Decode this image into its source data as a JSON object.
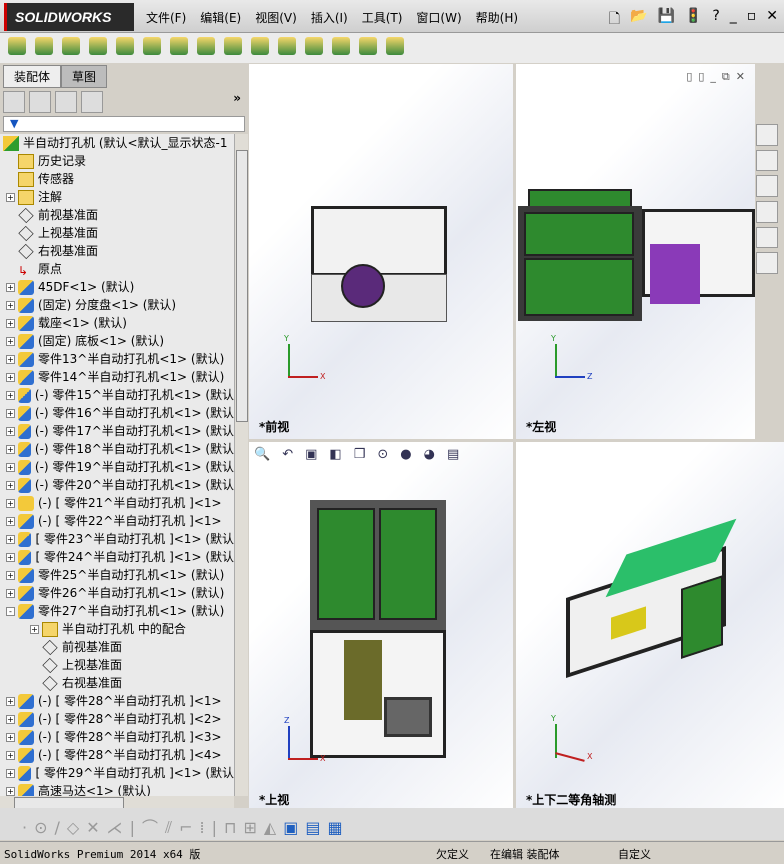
{
  "app": {
    "logo": "SOLIDWORKS",
    "menu": [
      "文件(F)",
      "编辑(E)",
      "视图(V)",
      "插入(I)",
      "工具(T)",
      "窗口(W)",
      "帮助(H)"
    ]
  },
  "side": {
    "tabs": [
      "装配体",
      "草图"
    ],
    "filter_icon": "funnel-icon",
    "tree": [
      {
        "label": "半自动打孔机  (默认<默认_显示状态-1",
        "icon": "root",
        "pm": "",
        "ind": 0
      },
      {
        "label": "历史记录",
        "icon": "fold",
        "pm": "",
        "ind": 1
      },
      {
        "label": "传感器",
        "icon": "fold",
        "pm": "",
        "ind": 1
      },
      {
        "label": "注解",
        "icon": "fold",
        "pm": "+",
        "ind": 1
      },
      {
        "label": "前视基准面",
        "icon": "plane",
        "pm": "",
        "ind": 1
      },
      {
        "label": "上视基准面",
        "icon": "plane",
        "pm": "",
        "ind": 1
      },
      {
        "label": "右视基准面",
        "icon": "plane",
        "pm": "",
        "ind": 1
      },
      {
        "label": "原点",
        "icon": "",
        "pm": "",
        "ind": 1
      },
      {
        "label": "45DF<1> (默认)",
        "icon": "asm",
        "pm": "+",
        "ind": 1
      },
      {
        "label": "(固定) 分度盘<1> (默认)",
        "icon": "asm",
        "pm": "+",
        "ind": 1
      },
      {
        "label": "载座<1> (默认)",
        "icon": "asm",
        "pm": "+",
        "ind": 1
      },
      {
        "label": "(固定) 底板<1> (默认)",
        "icon": "asm",
        "pm": "+",
        "ind": 1
      },
      {
        "label": "零件13^半自动打孔机<1> (默认)",
        "icon": "asm",
        "pm": "+",
        "ind": 1
      },
      {
        "label": "零件14^半自动打孔机<1> (默认)",
        "icon": "asm",
        "pm": "+",
        "ind": 1
      },
      {
        "label": "(-) 零件15^半自动打孔机<1> (默认",
        "icon": "asm",
        "pm": "+",
        "ind": 1
      },
      {
        "label": "(-) 零件16^半自动打孔机<1> (默认",
        "icon": "asm",
        "pm": "+",
        "ind": 1
      },
      {
        "label": "(-) 零件17^半自动打孔机<1> (默认",
        "icon": "asm",
        "pm": "+",
        "ind": 1
      },
      {
        "label": "(-) 零件18^半自动打孔机<1> (默认",
        "icon": "asm",
        "pm": "+",
        "ind": 1
      },
      {
        "label": "(-) 零件19^半自动打孔机<1> (默认",
        "icon": "asm",
        "pm": "+",
        "ind": 1
      },
      {
        "label": "(-) 零件20^半自动打孔机<1> (默认",
        "icon": "asm",
        "pm": "+",
        "ind": 1
      },
      {
        "label": "(-) [ 零件21^半自动打孔机 ]<1>",
        "icon": "part",
        "pm": "+",
        "ind": 1
      },
      {
        "label": "(-) [ 零件22^半自动打孔机 ]<1>",
        "icon": "asm",
        "pm": "+",
        "ind": 1
      },
      {
        "label": "[ 零件23^半自动打孔机 ]<1> (默认",
        "icon": "asm",
        "pm": "+",
        "ind": 1
      },
      {
        "label": "[ 零件24^半自动打孔机 ]<1> (默认",
        "icon": "asm",
        "pm": "+",
        "ind": 1
      },
      {
        "label": "零件25^半自动打孔机<1> (默认)",
        "icon": "asm",
        "pm": "+",
        "ind": 1
      },
      {
        "label": "零件26^半自动打孔机<1> (默认)",
        "icon": "asm",
        "pm": "+",
        "ind": 1
      },
      {
        "label": "零件27^半自动打孔机<1> (默认)",
        "icon": "asm",
        "pm": "-",
        "ind": 1
      },
      {
        "label": "半自动打孔机 中的配合",
        "icon": "fold",
        "pm": "+",
        "ind": 2
      },
      {
        "label": "前视基准面",
        "icon": "plane",
        "pm": "",
        "ind": 2
      },
      {
        "label": "上视基准面",
        "icon": "plane",
        "pm": "",
        "ind": 2
      },
      {
        "label": "右视基准面",
        "icon": "plane",
        "pm": "",
        "ind": 2
      },
      {
        "label": "(-) [ 零件28^半自动打孔机 ]<1>",
        "icon": "asm",
        "pm": "+",
        "ind": 1
      },
      {
        "label": "(-) [ 零件28^半自动打孔机 ]<2>",
        "icon": "asm",
        "pm": "+",
        "ind": 1
      },
      {
        "label": "(-) [ 零件28^半自动打孔机 ]<3>",
        "icon": "asm",
        "pm": "+",
        "ind": 1
      },
      {
        "label": "(-) [ 零件28^半自动打孔机 ]<4>",
        "icon": "asm",
        "pm": "+",
        "ind": 1
      },
      {
        "label": "[ 零件29^半自动打孔机 ]<1> (默认",
        "icon": "asm",
        "pm": "+",
        "ind": 1
      },
      {
        "label": "高速马达<1> (默认)",
        "icon": "asm",
        "pm": "+",
        "ind": 1
      }
    ]
  },
  "views": {
    "front": "*前视",
    "left": "*左视",
    "top": "*上视",
    "iso": "*上下二等角轴测"
  },
  "status": {
    "product": "SolidWorks Premium 2014 x64 版",
    "state": "欠定义",
    "mode": "在编辑 装配体",
    "custom": "自定义"
  },
  "colors": {
    "green": "#2e8a2e",
    "accent": "#1555c0"
  }
}
